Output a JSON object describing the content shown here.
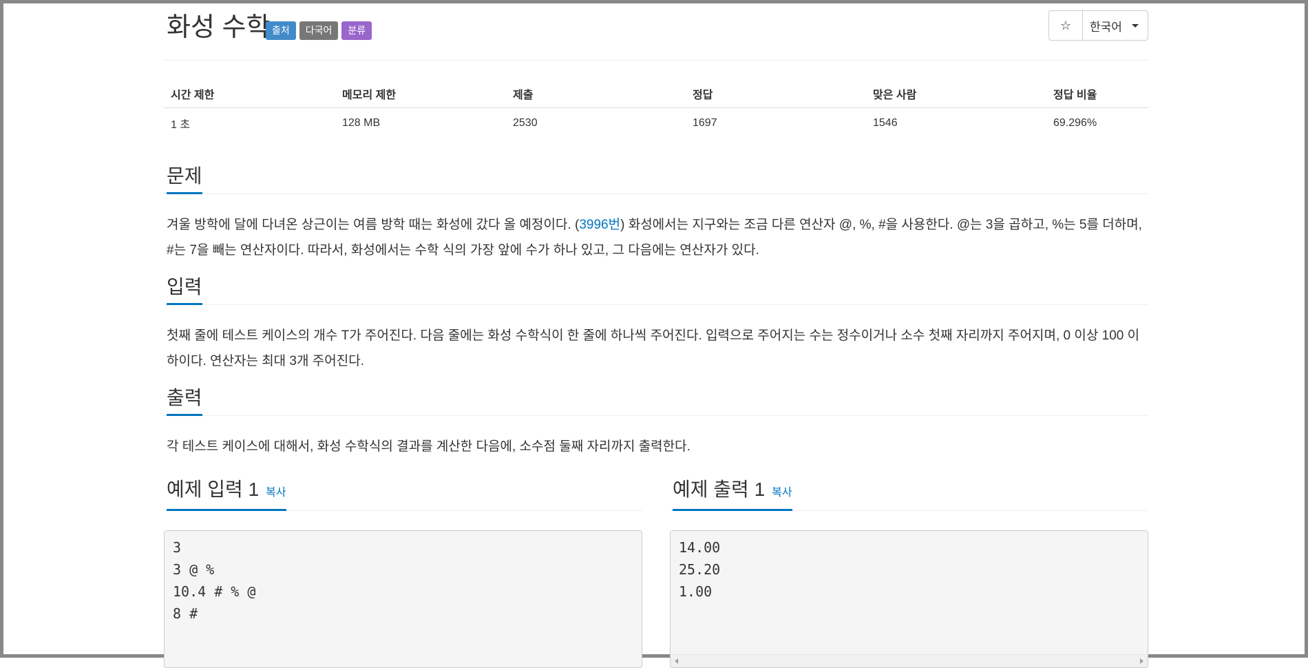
{
  "problem": {
    "title": "화성 수학",
    "labels": {
      "source": "출처",
      "multilang": "다국어",
      "category": "분류"
    },
    "star_icon": "☆",
    "language": "한국어"
  },
  "stats": {
    "headers": [
      "시간 제한",
      "메모리 제한",
      "제출",
      "정답",
      "맞은 사람",
      "정답 비율"
    ],
    "values": [
      "1 초",
      "128 MB",
      "2530",
      "1697",
      "1546",
      "69.296%"
    ]
  },
  "sections": {
    "problem": {
      "heading": "문제",
      "text_before": "겨울 방학에 달에 다녀온 상근이는 여름 방학 때는 화성에 갔다 올 예정이다. (",
      "link": "3996번",
      "text_after": ") 화성에서는 지구와는 조금 다른 연산자 @, %, #을 사용한다. @는 3을 곱하고, %는 5를 더하며, #는 7을 빼는 연산자이다. 따라서, 화성에서는 수학 식의 가장 앞에 수가 하나 있고, 그 다음에는 연산자가 있다."
    },
    "input": {
      "heading": "입력",
      "text": "첫째 줄에 테스트 케이스의 개수 T가 주어진다. 다음 줄에는 화성 수학식이 한 줄에 하나씩 주어진다. 입력으로 주어지는 수는 정수이거나 소수 첫째 자리까지 주어지며, 0 이상 100 이하이다. 연산자는 최대 3개 주어진다."
    },
    "output": {
      "heading": "출력",
      "text": "각 테스트 케이스에 대해서, 화성 수학식의 결과를 계산한 다음에, 소수점 둘째 자리까지 출력한다."
    }
  },
  "samples": {
    "input": {
      "heading": "예제 입력 1",
      "copy": "복사",
      "lines": [
        "3",
        "3 @ %",
        "10.4 # % @",
        "8 #"
      ]
    },
    "output": {
      "heading": "예제 출력 1",
      "copy": "복사",
      "lines": [
        "14.00",
        "25.20",
        "1.00"
      ]
    }
  },
  "colors": {
    "accent": "#0076c0",
    "label_source": "#428bca",
    "label_multilang": "#777777",
    "label_category": "#9966cc"
  }
}
